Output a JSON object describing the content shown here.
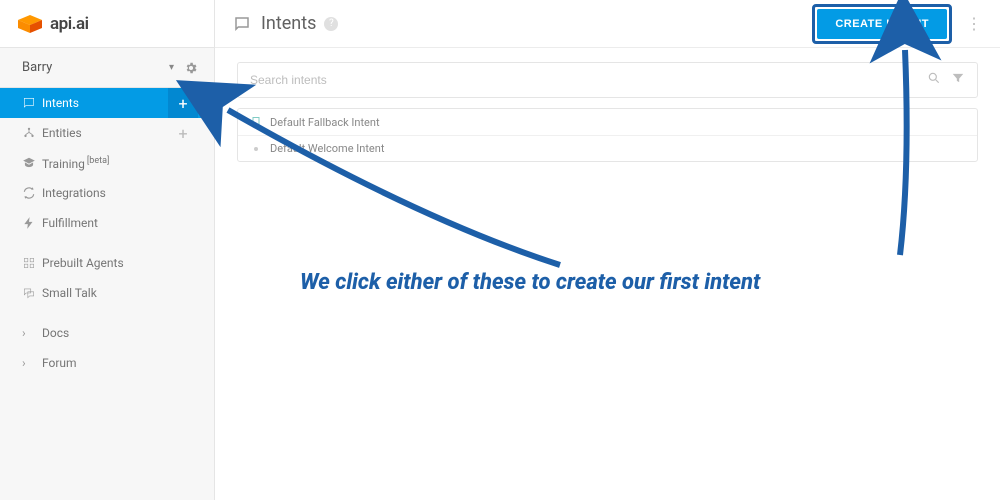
{
  "brand": {
    "logo_text": "api.ai",
    "accent": "#039be5"
  },
  "agent": {
    "name": "Barry"
  },
  "sidebar": {
    "items": [
      {
        "label": "Intents",
        "has_add": true,
        "active": true
      },
      {
        "label": "Entities",
        "has_add": true,
        "active": false
      },
      {
        "label": "Training",
        "sup": "[beta]",
        "active": false
      },
      {
        "label": "Integrations",
        "active": false
      },
      {
        "label": "Fulfillment",
        "active": false
      },
      {
        "label": "Prebuilt Agents",
        "active": false,
        "section": 2
      },
      {
        "label": "Small Talk",
        "active": false,
        "section": 2
      },
      {
        "label": "Docs",
        "active": false,
        "section": 3,
        "chevron": true
      },
      {
        "label": "Forum",
        "active": false,
        "section": 3,
        "chevron": true
      }
    ]
  },
  "header": {
    "title": "Intents",
    "create_label": "CREATE INTENT"
  },
  "search": {
    "placeholder": "Search intents"
  },
  "intents": [
    {
      "name": "Default Fallback Intent"
    },
    {
      "name": "Default Welcome Intent"
    }
  ],
  "annotation": {
    "text": "We click either of these to create our first intent"
  }
}
